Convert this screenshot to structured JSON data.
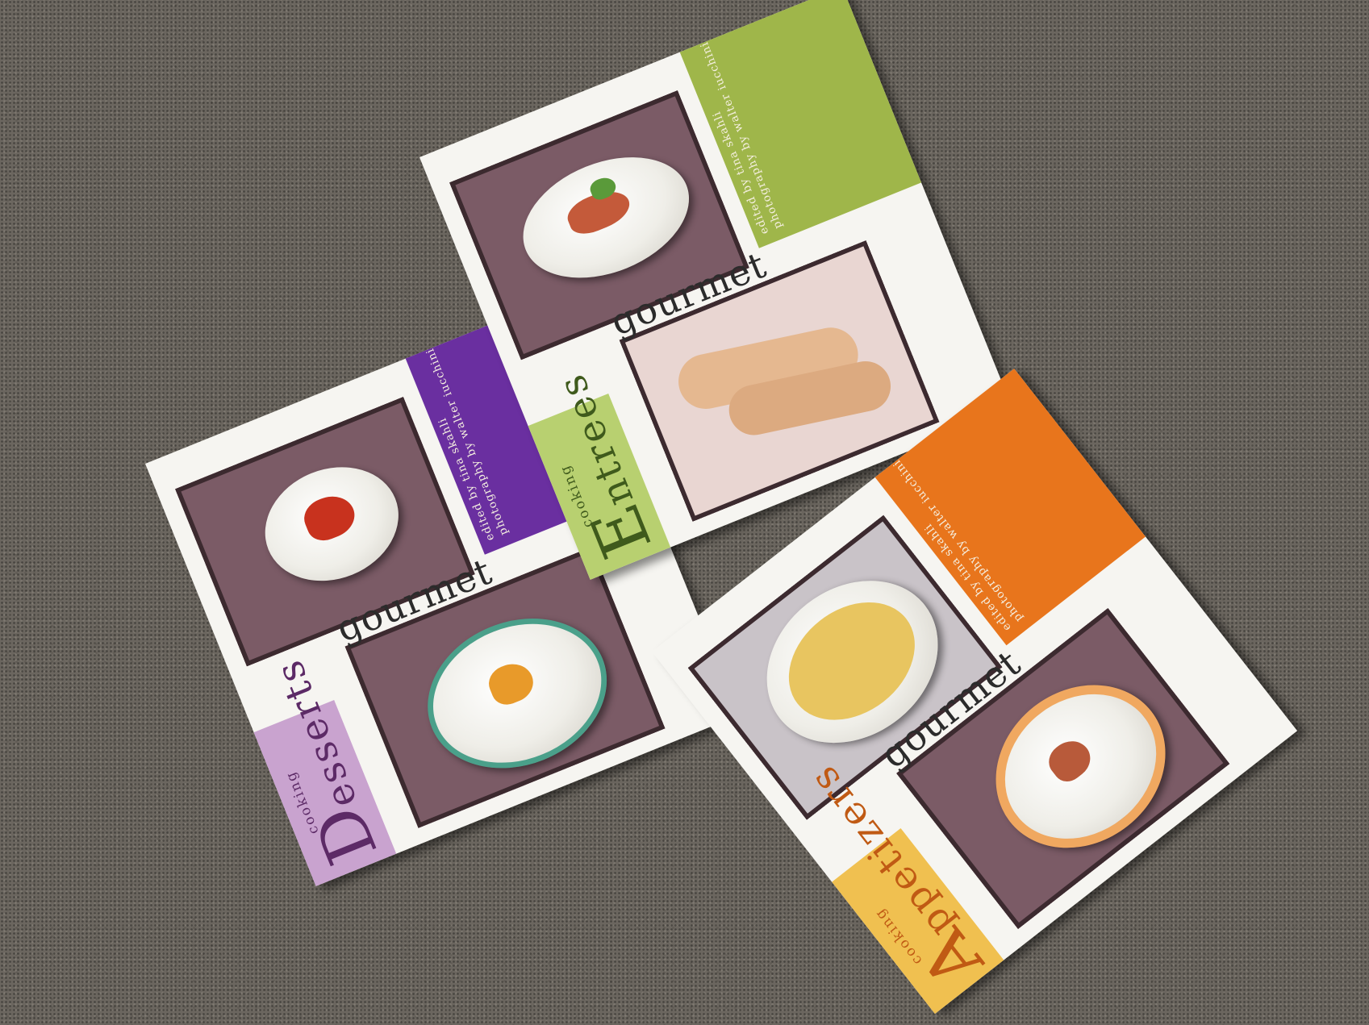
{
  "books": [
    {
      "id": "desserts",
      "brand": "gourmet",
      "title_initial": "D",
      "title_rest": "esserts",
      "series": "cooking",
      "credit_line_1": "edited by tina skahli",
      "credit_line_2": "photography by walter iucchini",
      "colors": {
        "band_left": "#c9a3cf",
        "band_right": "#6a2fa0",
        "title": "#5c2a66"
      }
    },
    {
      "id": "entrees",
      "brand": "gourmet",
      "title_initial": "E",
      "title_rest": "ntrees",
      "series": "cooking",
      "credit_line_1": "edited by tina skahli",
      "credit_line_2": "photography by walter iucchini",
      "colors": {
        "band_left": "#b8d070",
        "band_right": "#9fb64a",
        "title": "#3f5a1c"
      }
    },
    {
      "id": "appetizers",
      "brand": "gourmet",
      "title_initial": "A",
      "title_rest": "ppetizers",
      "series": "cooking",
      "credit_line_1": "edited by tina skahli",
      "credit_line_2": "photography by walter iucchini",
      "colors": {
        "band_left": "#f0c050",
        "band_right": "#e8751c",
        "title": "#c05a14"
      }
    }
  ]
}
